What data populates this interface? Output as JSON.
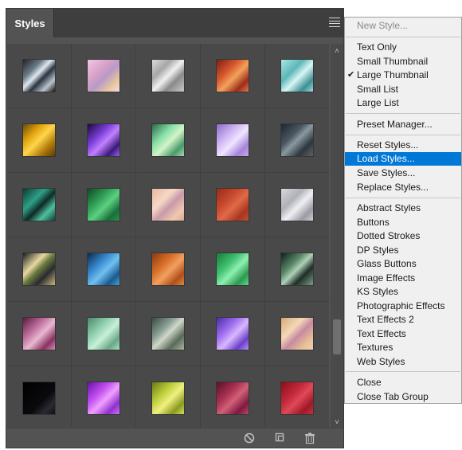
{
  "panel": {
    "tab_label": "Styles"
  },
  "swatches": [
    "linear-gradient(135deg,#222 0%,#6a7a8a 30%,#dfe8ee 45%,#2a3440 60%,#b9c4cc 80%,#111 100%)",
    "linear-gradient(135deg,#f2c5e6 0%,#d7a2c7 35%,#b89ac9 55%,#e8c89c 80%,#f6d9ef 100%)",
    "linear-gradient(135deg,#dcdcdc 0%,#a6a6a6 30%,#f0f0f0 50%,#8a8a8a 70%,#c9c9c9 100%)",
    "linear-gradient(135deg,#7a1e14 0%,#d9582e 35%,#f2a35a 55%,#9b2d1c 80%,#e07a4a 100%)",
    "linear-gradient(135deg,#a8e8e6 0%,#5db6b8 35%,#d8f6f4 55%,#3d8f93 80%,#9edbe0 100%)",
    "linear-gradient(135deg,#6a4a06 0%,#e2a40e 30%,#ffd54a 50%,#b17a0a 75%,#5a3c06 100%)",
    "linear-gradient(135deg,#1a0a38 0%,#7b3ed8 35%,#c080ff 55%,#3a1a78 80%,#a060ee 100%)",
    "linear-gradient(135deg,#2a6a4a 0%,#8ae0a8 35%,#d2f4c8 55%,#4a9a6a 80%,#a8d8b8 100%)",
    "linear-gradient(135deg,#8a6ac8 0%,#d0b8f4 35%,#f0e4ff 55%,#a684d8 80%,#c8a8ee 100%)",
    "linear-gradient(135deg,#1e2630 0%,#4a5660 35%,#8a9aa0 50%,#2e363e 75%,#5a6668 100%)",
    "linear-gradient(135deg,#0a3a30 0%,#2ea088 35%,#0e2a24 55%,#4ec0a0 75%,#123c30 100%)",
    "linear-gradient(135deg,#0e4a22 0%,#30a058 35%,#5ed080 55%,#18703a 80%,#2e8e4c 100%)",
    "linear-gradient(135deg,#e8b8a0 0%,#f6d8c8 35%,#c89aa8 55%,#f0c8b0 80%,#d8a890 100%)",
    "linear-gradient(135deg,#9a2a18 0%,#c84a2e 35%,#e06a48 55%,#a83620 80%,#c0503a 100%)",
    "linear-gradient(135deg,#d8d8dc 0%,#b0b0b8 35%,#f0f0f4 55%,#9a9aa4 80%,#d0d0d8 100%)",
    "linear-gradient(135deg,#1a1a20 0%,#e8d8a0 35%,#6a7a40 50%,#2a2a30 70%,#c8b880 100%)",
    "linear-gradient(135deg,#0a2a4a 0%,#3a8ad0 35%,#70c0f0 55%,#1a5a90 80%,#4aa0d8 100%)",
    "linear-gradient(135deg,#8a3a10 0%,#d8702a 35%,#f2a060 55%,#b0501a 80%,#e08840 100%)",
    "linear-gradient(135deg,#1a7a3a 0%,#40c070 35%,#8ef0b0 55%,#2a9a50 80%,#60d890 100%)",
    "linear-gradient(135deg,#0e1e18 0%,#5a8a6a 35%,#b0d0b8 50%,#1e2e26 70%,#7aa088 100%)",
    "linear-gradient(135deg,#5a1a3a 0%,#c070a0 35%,#e8b8d0 55%,#8a3060 80%,#d090b8 100%)",
    "linear-gradient(135deg,#4a8a6a 0%,#90d0b0 35%,#c8f0d8 55%,#6aa888 80%,#a8dcc0 100%)",
    "linear-gradient(135deg,#3a4a3a 0%,#8aa098 35%,#d0d8c8 50%,#5a6a5a 75%,#a8b8a0 100%)",
    "linear-gradient(135deg,#4a2aa8 0%,#a070f0 35%,#d8b8ff 55%,#6a40c8 80%,#b890f8 100%)",
    "linear-gradient(135deg,#d8a878 0%,#f4d8b8 35%,#c88aa0 55%,#e8c098 80%,#f0d0b0 100%)",
    "linear-gradient(135deg,#000000 0%,#0a0a0e 60%,#2a2a34 80%,#101014 100%)",
    "linear-gradient(135deg,#6a10a8 0%,#c050f0 35%,#f0a0ff 55%,#9030d0 80%,#d070f8 100%)",
    "linear-gradient(135deg,#6a7a10 0%,#c0d040 35%,#f0f080 55%,#8a9a20 80%,#d0e060 100%)",
    "linear-gradient(135deg,#5a1028 0%,#a83050 35%,#d06078 55%,#801840 80%,#b84868 100%)",
    "linear-gradient(135deg,#8a0e1e 0%,#c0283a 35%,#e04858 55%,#a01828 80%,#c83040 100%)"
  ],
  "menu": {
    "new_style": "New Style...",
    "text_only": "Text Only",
    "small_thumbnail": "Small Thumbnail",
    "large_thumbnail": "Large Thumbnail",
    "small_list": "Small List",
    "large_list": "Large List",
    "preset_manager": "Preset Manager...",
    "reset_styles": "Reset Styles...",
    "load_styles": "Load Styles...",
    "save_styles": "Save Styles...",
    "replace_styles": "Replace Styles...",
    "libraries": [
      "Abstract Styles",
      "Buttons",
      "Dotted Strokes",
      "DP Styles",
      "Glass Buttons",
      "Image Effects",
      "KS Styles",
      "Photographic Effects",
      "Text Effects 2",
      "Text Effects",
      "Textures",
      "Web Styles"
    ],
    "close": "Close",
    "close_tab_group": "Close Tab Group",
    "checkmark": "✔"
  },
  "colors": {
    "highlight": "#0078d7",
    "panel_bg": "#535353",
    "menu_bg": "#f0f0f0"
  }
}
